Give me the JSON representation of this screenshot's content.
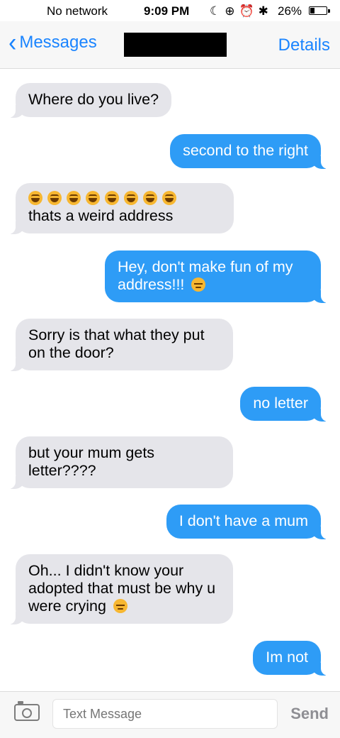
{
  "status_bar": {
    "carrier": "No network",
    "time": "9:09 PM",
    "icons": [
      "moon-icon",
      "rotation-lock-icon",
      "alarm-icon",
      "bluetooth-icon"
    ],
    "battery_percent": "26%"
  },
  "nav": {
    "back_label": "Messages",
    "contact_name": "",
    "details_label": "Details",
    "accent_color": "#1a84ff"
  },
  "messages": [
    {
      "side": "in",
      "text": "Where do you live?"
    },
    {
      "side": "out",
      "text": "second to the right"
    },
    {
      "side": "in",
      "text": "thats a weird address",
      "emoji_prefix": [
        "laugh",
        "laugh",
        "laugh",
        "laugh",
        "laugh",
        "laugh",
        "laugh",
        "laugh"
      ]
    },
    {
      "side": "out",
      "text": "Hey, don't make fun of my address!!!",
      "emoji_suffix": "sad"
    },
    {
      "side": "in",
      "text": "Sorry is that what they put on the door?"
    },
    {
      "side": "out",
      "text": "no letter"
    },
    {
      "side": "in",
      "text": "but your mum gets letter????"
    },
    {
      "side": "out",
      "text": "I don't have a mum"
    },
    {
      "side": "in",
      "text": "Oh... I didn't know your adopted that must be why u were crying",
      "emoji_suffix": "sad"
    },
    {
      "side": "out",
      "text": "Im not"
    }
  ],
  "input_bar": {
    "placeholder": "Text Message",
    "send_label": "Send"
  },
  "colors": {
    "incoming_bubble": "#e5e5ea",
    "outgoing_bubble": "#2e9cf6"
  }
}
